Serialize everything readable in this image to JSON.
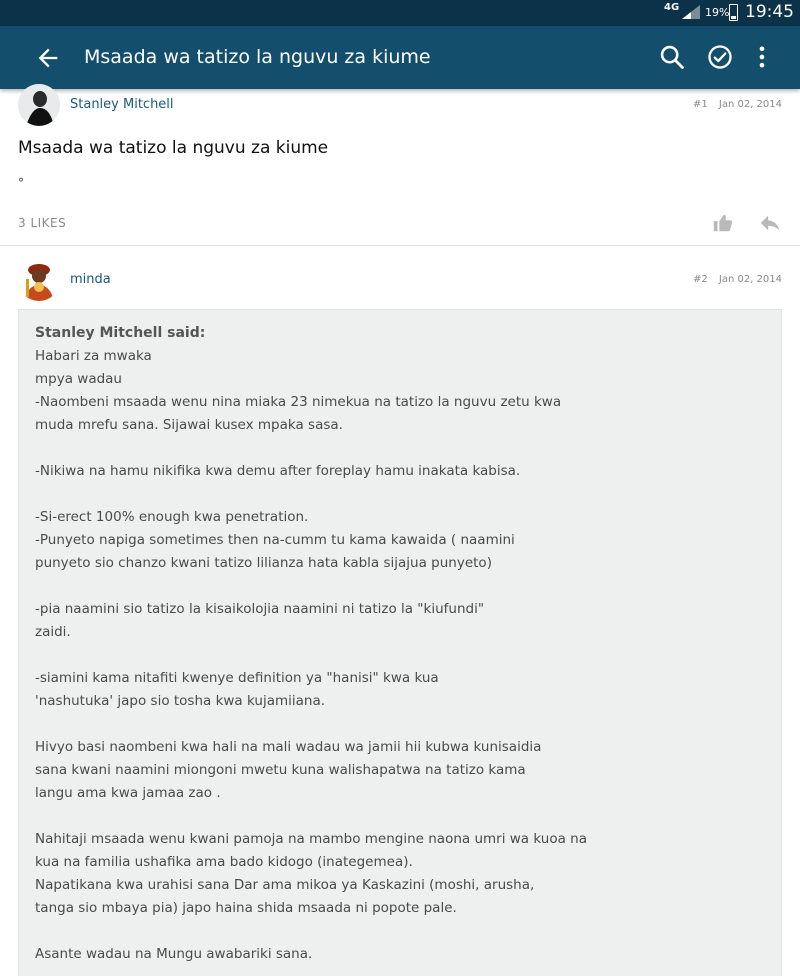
{
  "status_bar": {
    "network": "4G",
    "battery": "19%",
    "time": "19:45"
  },
  "app_bar": {
    "title": "Msaada wa tatizo la nguvu za kiume",
    "back_icon": "arrow-left-icon",
    "search_icon": "search-icon",
    "check_icon": "check-circle-icon",
    "more_icon": "more-vertical-icon"
  },
  "posts": [
    {
      "author": "Stanley Mitchell",
      "number": "#1",
      "date": "Jan 02, 2014",
      "title": "Msaada wa tatizo la nguvu za kiume",
      "body": "°",
      "likes": "3 LIKES"
    },
    {
      "author": "minda",
      "number": "#2",
      "date": "Jan 02, 2014",
      "quote": {
        "said": "Stanley Mitchell said:",
        "lines": [
          "Habari za mwaka",
          "mpya wadau",
          "-Naombeni msaada wenu nina miaka 23 nimekua na tatizo la nguvu zetu kwa",
          "muda mrefu sana. Sijawai kusex mpaka sasa.",
          "",
          "-Nikiwa na hamu nikifika kwa demu after foreplay hamu inakata kabisa.",
          "",
          "-Si-erect 100% enough kwa penetration.",
          "-Punyeto napiga sometimes then na-cumm tu kama kawaida ( naamini",
          "punyeto sio chanzo kwani tatizo lilianza hata kabla sijajua punyeto)",
          "",
          "-pia naamini sio tatizo la kisaikolojia naamini ni tatizo la \"kiufundi\"",
          "zaidi.",
          "",
          "-siamini kama nitafiti kwenye definition ya \"hanisi\" kwa kua",
          "'nashutuka' japo sio tosha kwa kujamiiana.",
          "",
          "Hivyo basi naombeni kwa hali na mali wadau wa jamii hii kubwa kunisaidia",
          "sana kwani naamini miongoni mwetu kuna walishapatwa na tatizo kama",
          "langu ama kwa jamaa zao .",
          "",
          "Nahitaji msaada wenu kwani pamoja na mambo mengine naona umri wa kuoa na",
          "kua na familia ushafika ama bado kidogo (inategemea).",
          "Napatikana kwa urahisi sana Dar ama mikoa ya Kaskazini (moshi, arusha,",
          "tanga sio mbaya pia) japo haina shida msaada ni popote pale.",
          "",
          "Asante wadau na Mungu awabariki sana."
        ]
      }
    }
  ]
}
